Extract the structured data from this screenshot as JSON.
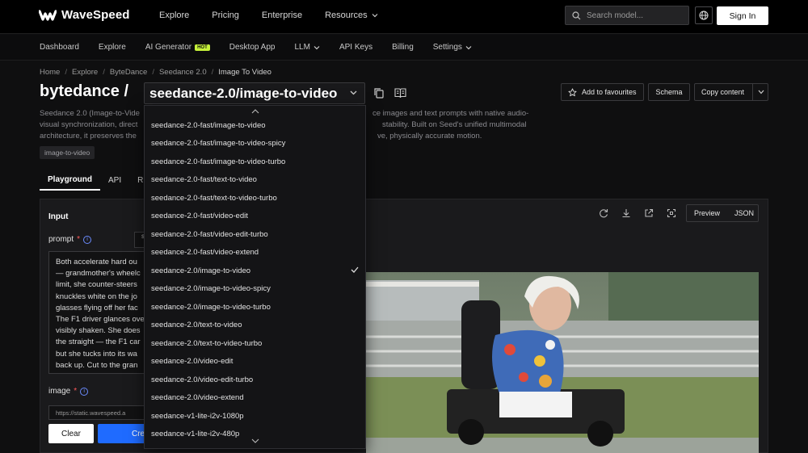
{
  "brand": {
    "name": "WaveSpeed"
  },
  "topnav": {
    "items": [
      "Explore",
      "Pricing",
      "Enterprise",
      "Resources"
    ]
  },
  "search": {
    "placeholder": "Search model..."
  },
  "signin_label": "Sign In",
  "subnav": {
    "items": [
      "Dashboard",
      "Explore",
      "AI Generator",
      "Desktop App",
      "LLM",
      "API Keys",
      "Billing",
      "Settings"
    ],
    "hot_badge": "HOT"
  },
  "breadcrumb": [
    "Home",
    "Explore",
    "ByteDance",
    "Seedance 2.0",
    "Image To Video"
  ],
  "header": {
    "owner": "bytedance /",
    "model": "seedance-2.0/image-to-video",
    "fav_label": "Add to favourites",
    "schema_label": "Schema",
    "copy_label": "Copy content"
  },
  "description": {
    "line1_left": "Seedance 2.0 (Image-to-Vide",
    "line1_right": "ce images and text prompts with native audio-",
    "line2_left": "visual synchronization, direct",
    "line2_right": "stability. Built on Seed's unified multimodal",
    "line3_left": "architecture, it preserves the",
    "line3_right": "ve, physically accurate motion."
  },
  "tag": "image-to-video",
  "tabs": [
    "Playground",
    "API",
    "R"
  ],
  "input": {
    "heading": "Input",
    "prompt_label": "prompt",
    "enhance_label": "s",
    "prompt_lines": [
      "Both accelerate hard ou",
      "— grandmother's wheelc",
      "limit, she counter-steers",
      "knuckles white on the jo",
      "glasses flying off her fac",
      "The F1 driver glances ove",
      "visibly shaken. She does",
      "the straight — the F1 car",
      "but she tucks into its wa",
      "back up. Cut to the gran"
    ],
    "image_label": "image",
    "image_value": "https://static.wavespeed.a",
    "clear_label": "Clear",
    "create_label": "Cre"
  },
  "output": {
    "preview_label": "Preview",
    "json_label": "JSON"
  },
  "dropdown": {
    "selected": "seedance-2.0/image-to-video",
    "options": [
      "seedance-2.0-fast/image-to-video",
      "seedance-2.0-fast/image-to-video-spicy",
      "seedance-2.0-fast/image-to-video-turbo",
      "seedance-2.0-fast/text-to-video",
      "seedance-2.0-fast/text-to-video-turbo",
      "seedance-2.0-fast/video-edit",
      "seedance-2.0-fast/video-edit-turbo",
      "seedance-2.0-fast/video-extend",
      "seedance-2.0/image-to-video",
      "seedance-2.0/image-to-video-spicy",
      "seedance-2.0/image-to-video-turbo",
      "seedance-2.0/text-to-video",
      "seedance-2.0/text-to-video-turbo",
      "seedance-2.0/video-edit",
      "seedance-2.0/video-edit-turbo",
      "seedance-2.0/video-extend",
      "seedance-v1-lite-i2v-1080p",
      "seedance-v1-lite-i2v-480p"
    ]
  },
  "colors": {
    "accent": "#1f6bff",
    "hot": "#c6f23a",
    "background": "#0f0f10"
  }
}
